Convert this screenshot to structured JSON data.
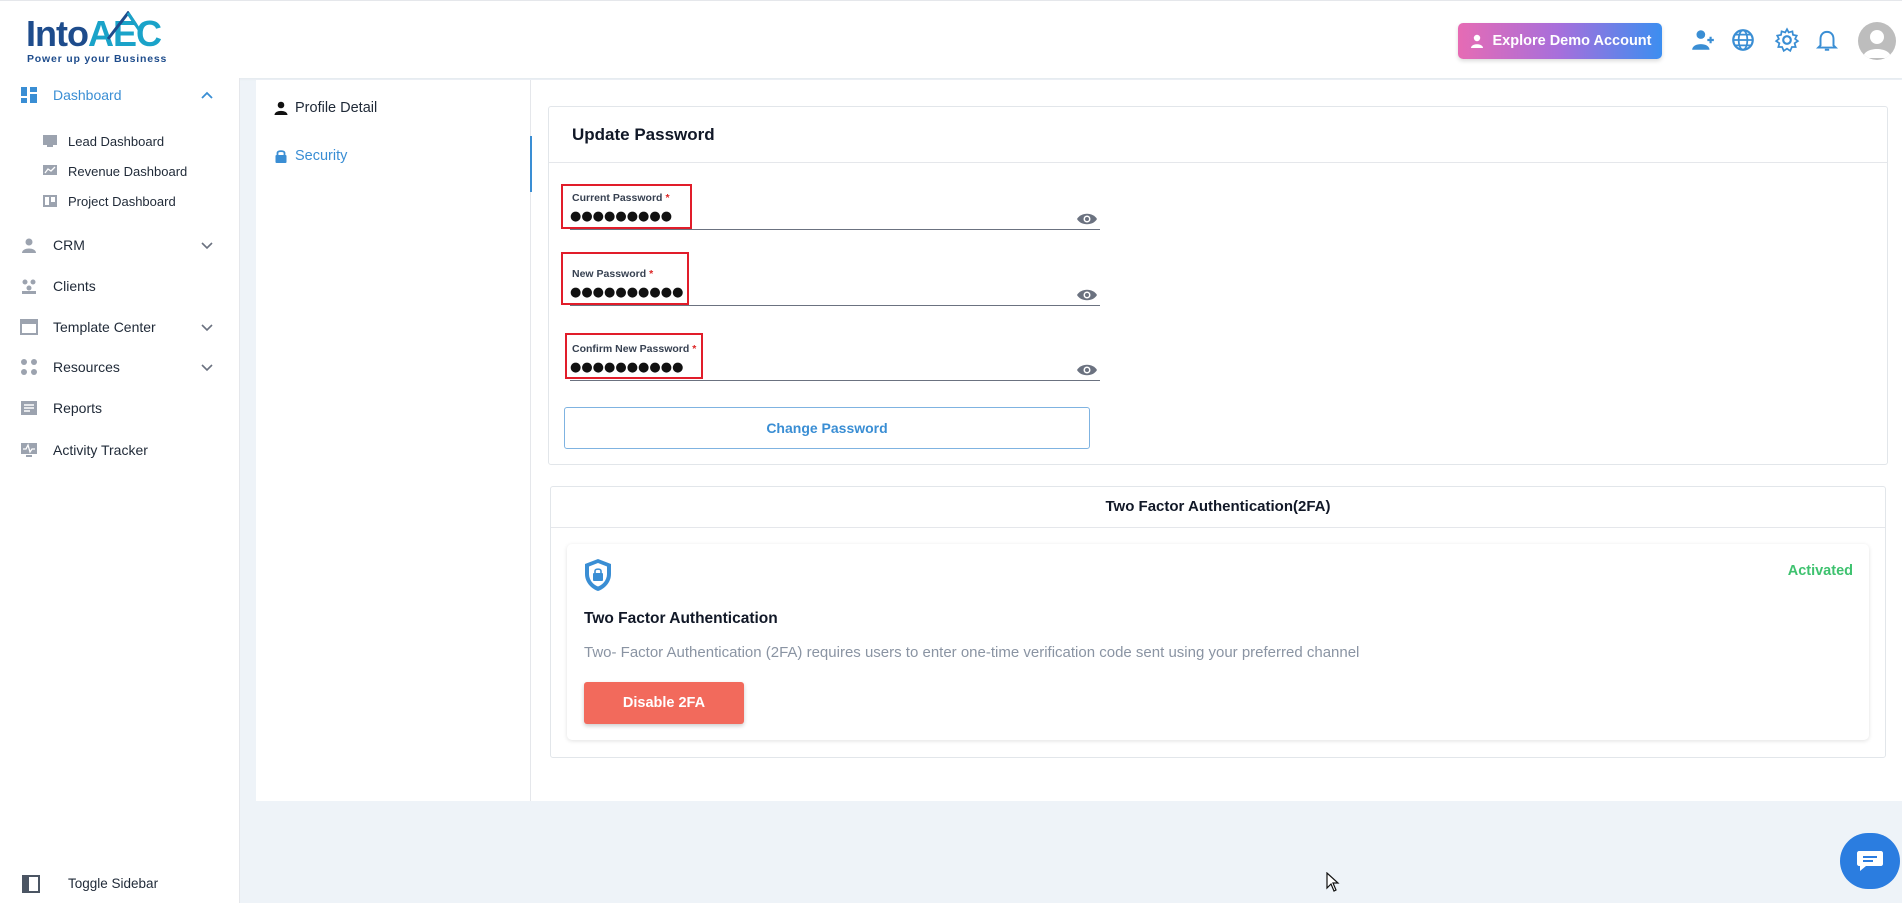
{
  "brand": {
    "logo_part1": "Into",
    "logo_part2": "AEC",
    "tagline": "Power up your Business",
    "accent": "#3a8ed4"
  },
  "header": {
    "demo_button": "Explore Demo Account",
    "icons": [
      "user-add-icon",
      "globe-icon",
      "gear-icon",
      "bell-icon",
      "avatar"
    ]
  },
  "sidebar": {
    "items": [
      {
        "label": "Dashboard",
        "icon": "dashboard-icon",
        "expanded": true
      },
      {
        "label": "CRM",
        "icon": "crm-icon"
      },
      {
        "label": "Clients",
        "icon": "clients-icon"
      },
      {
        "label": "Template Center",
        "icon": "template-icon"
      },
      {
        "label": "Resources",
        "icon": "resources-icon"
      },
      {
        "label": "Reports",
        "icon": "reports-icon"
      },
      {
        "label": "Activity Tracker",
        "icon": "activity-icon"
      }
    ],
    "dashboard_sub": [
      {
        "label": "Lead Dashboard"
      },
      {
        "label": "Revenue Dashboard"
      },
      {
        "label": "Project Dashboard"
      }
    ],
    "toggle_label": "Toggle Sidebar"
  },
  "tabs": [
    {
      "label": "Profile Detail"
    },
    {
      "label": "Security"
    }
  ],
  "update_password": {
    "title": "Update Password",
    "fields": [
      {
        "label": "Current Password",
        "value": "●●●●●●●●●"
      },
      {
        "label": "New Password",
        "value": "●●●●●●●●●●"
      },
      {
        "label": "Confirm New Password",
        "value": "●●●●●●●●●●"
      }
    ],
    "required_mark": "*",
    "button": "Change Password"
  },
  "two_factor": {
    "section_title": "Two Factor Authentication(2FA)",
    "status": "Activated",
    "status_color": "#3ec26f",
    "title": "Two Factor Authentication",
    "description": "Two- Factor Authentication (2FA) requires users to enter one-time verification code sent using your preferred channel",
    "button": "Disable 2FA",
    "button_color": "#f26a5c"
  }
}
